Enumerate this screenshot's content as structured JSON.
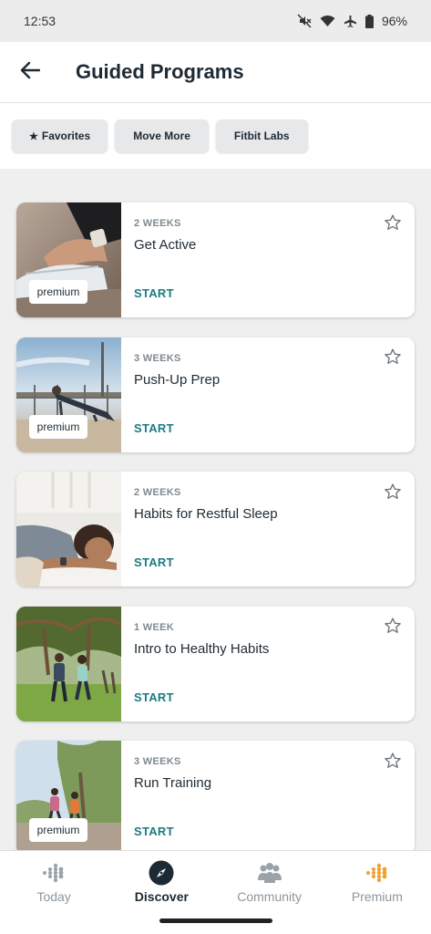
{
  "status_bar": {
    "time": "12:53",
    "battery": "96%"
  },
  "header": {
    "title": "Guided Programs"
  },
  "filters": [
    {
      "icon": "★",
      "label": "Favorites"
    },
    {
      "label": "Move More"
    },
    {
      "label": "Fitbit Labs"
    }
  ],
  "programs": [
    {
      "duration": "2 WEEKS",
      "name": "Get Active",
      "action": "START",
      "badge": "premium"
    },
    {
      "duration": "3 WEEKS",
      "name": "Push-Up Prep",
      "action": "START",
      "badge": "premium"
    },
    {
      "duration": "2 WEEKS",
      "name": "Habits for Restful Sleep",
      "action": "START"
    },
    {
      "duration": "1 WEEK",
      "name": "Intro to Healthy Habits",
      "action": "START"
    },
    {
      "duration": "3 WEEKS",
      "name": "Run Training",
      "action": "START",
      "badge": "premium"
    }
  ],
  "nav": [
    {
      "label": "Today",
      "icon": "fitbit-dots-icon"
    },
    {
      "label": "Discover",
      "icon": "compass-icon",
      "active": true
    },
    {
      "label": "Community",
      "icon": "community-icon"
    },
    {
      "label": "Premium",
      "icon": "premium-dots-icon"
    }
  ],
  "colors": {
    "accent": "#1b7b83",
    "premium": "#f0a030"
  }
}
